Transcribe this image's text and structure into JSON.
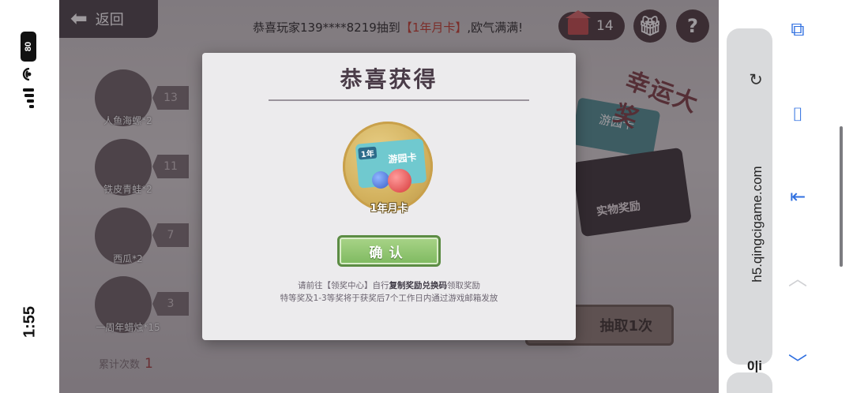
{
  "status": {
    "time": "1:55",
    "battery": "80"
  },
  "game": {
    "back_label": "返回",
    "marquee": {
      "prefix": "恭喜玩家139****8219抽到",
      "highlight": "【1年月卡】",
      "suffix": ",欧气满满!"
    },
    "coins": "14",
    "items": [
      {
        "label": "人鱼海螺*2",
        "count": "13"
      },
      {
        "label": "铁皮青蛙*2",
        "count": "11"
      },
      {
        "label": "西瓜*2",
        "count": "7"
      },
      {
        "label": "一周年蜡烛*15",
        "count": "3"
      }
    ],
    "total": {
      "label": "累计次数",
      "value": "1"
    },
    "lucky_title": "幸运大奖",
    "park_card": "游园卡",
    "gift_box_label": "实物奖励",
    "draw_button": "抽取1次",
    "help_icon": "?"
  },
  "modal": {
    "title": "恭喜获得",
    "prize_name": "1年月卡",
    "card_badge": "1年",
    "card_name": "游园卡",
    "confirm": "确认",
    "note1": {
      "a": "请前往【领奖中心】自行",
      "b": "复制奖励兑换码",
      "c": "领取奖励"
    },
    "note2": "特等奖及1-3等奖将于获奖后7个工作日内通过游戏邮箱发放"
  },
  "browser": {
    "url": "h5.qingcigame.com",
    "tabs_icon": "0|i"
  },
  "colors": {
    "accent_green": "#7eb960",
    "highlight_red": "#c0392b",
    "browser_blue": "#2f6fe0"
  }
}
